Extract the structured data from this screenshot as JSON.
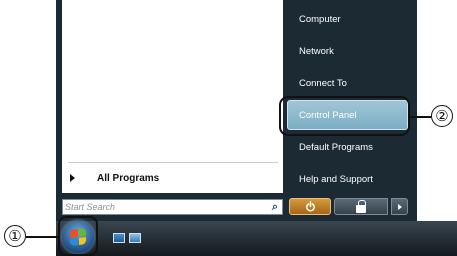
{
  "left_pane": {
    "all_programs_label": "All Programs",
    "search_placeholder": "Start Search"
  },
  "right_pane": {
    "items": [
      "Computer",
      "Network",
      "Connect To",
      "Control Panel",
      "Default Programs",
      "Help and Support"
    ],
    "highlighted_item": "Control Panel"
  },
  "power_bar": {
    "power_icon": "power-icon",
    "lock_icon": "lock-icon",
    "more_icon": "arrow-right-icon"
  },
  "taskbar": {
    "start_button_icon": "windows-logo-icon",
    "quick_launch_icons": [
      "show-desktop-icon",
      "switch-windows-icon"
    ]
  },
  "callouts": {
    "start_button": "①",
    "control_panel": "②"
  },
  "colors": {
    "menu_background": "#1c2a33",
    "highlight": "#7aaec4",
    "power_button": "#c07f26"
  }
}
